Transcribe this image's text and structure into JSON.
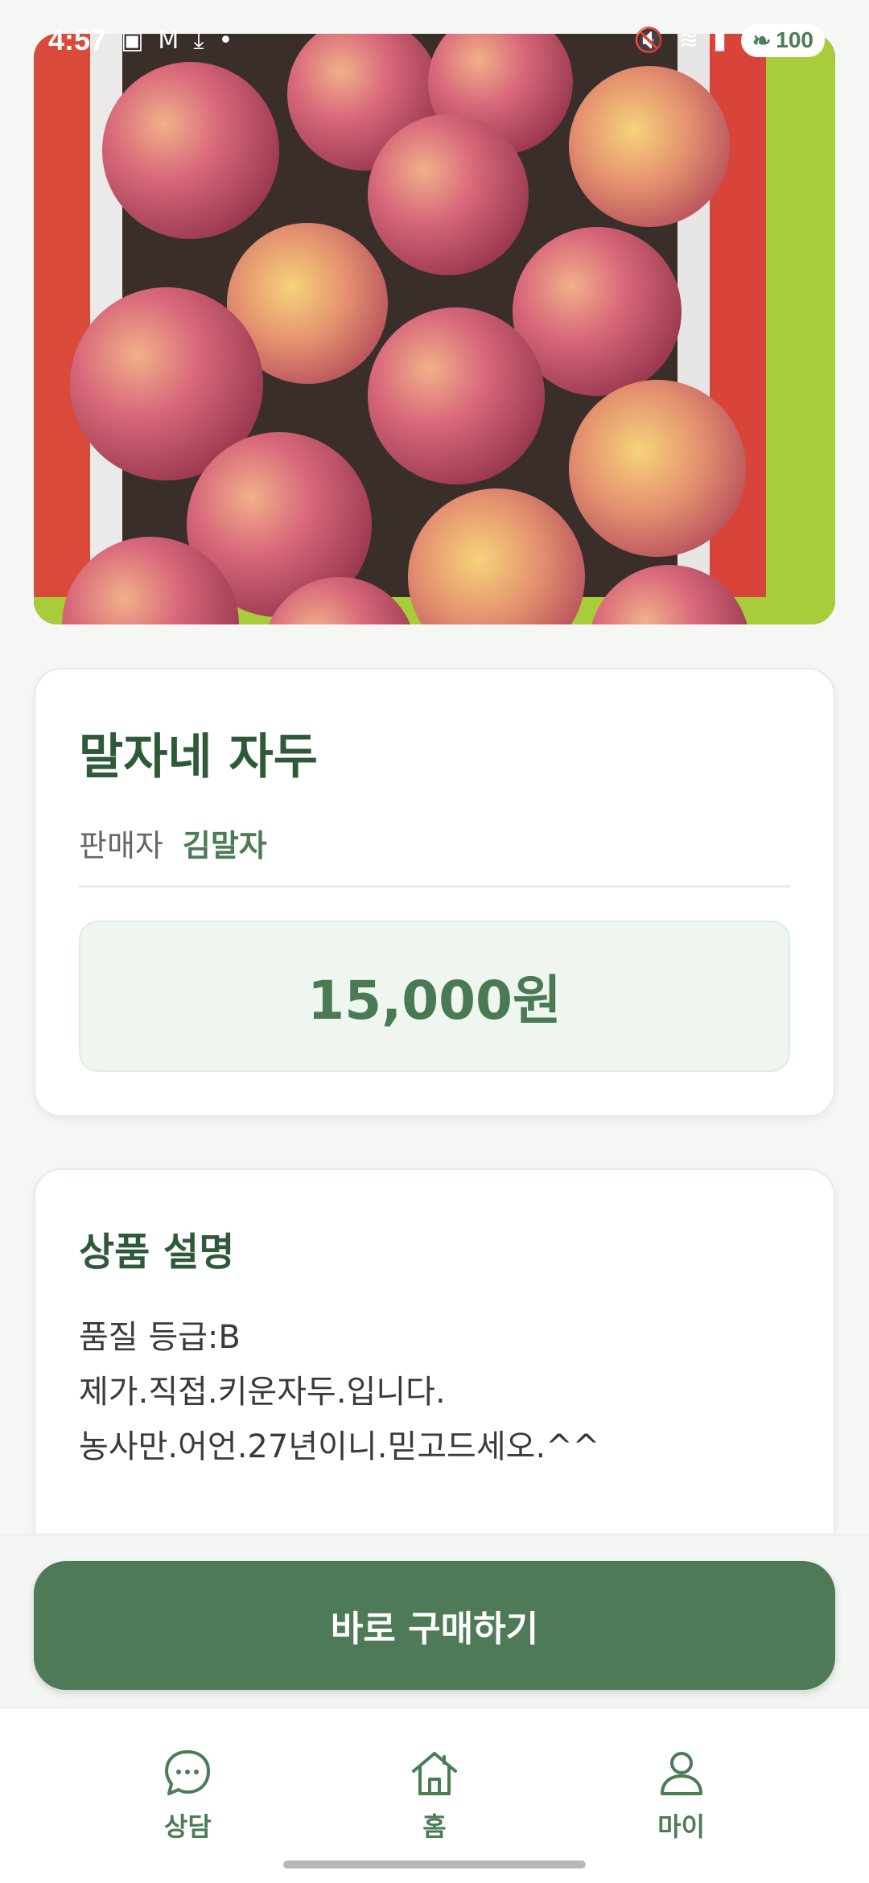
{
  "status_bar": {
    "time": "4:57",
    "battery": "100",
    "left_icons": [
      "gallery-icon",
      "gmail-icon",
      "download-icon",
      "dot-icon"
    ],
    "right_icons": [
      "mute-icon",
      "wifi-icon",
      "signal-icon"
    ]
  },
  "product": {
    "photo": "plums-in-box",
    "title": "말자네 자두",
    "seller_label": "판매자",
    "seller_name": "김말자",
    "price": "15,000원"
  },
  "description": {
    "title": "상품 설명",
    "lines": [
      "품질 등급:B",
      "제가.직접.키운자두.입니다.",
      "농사만.어언.27년이니.믿고드세오.^^"
    ]
  },
  "purchase": {
    "button_label": "바로 구매하기"
  },
  "bottom_nav": {
    "items": [
      {
        "label": "상담",
        "icon": "chat-icon"
      },
      {
        "label": "홈",
        "icon": "home-icon"
      },
      {
        "label": "마이",
        "icon": "person-icon"
      }
    ]
  },
  "colors": {
    "primary": "#4e7a58",
    "title": "#2f5a3a",
    "price_bg": "#eef6ef",
    "background": "#f5f7f5"
  }
}
